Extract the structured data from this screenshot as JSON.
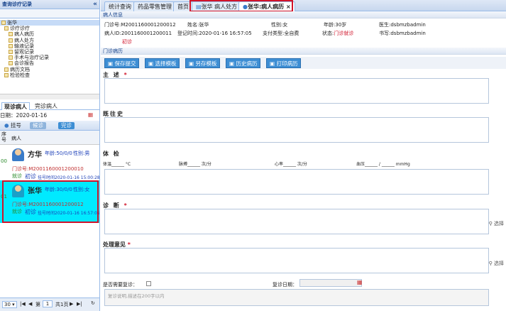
{
  "left": {
    "panel_title": "查询诊疗记录",
    "tree": [
      "张华",
      "诊疗诊疗",
      "病人病历",
      "病人处方",
      "输液记录",
      "留观记录",
      "手术与治疗记录",
      "会诊报告",
      "病历文档",
      "检验检查"
    ],
    "tabs": [
      "现诊病人",
      "完诊病人"
    ],
    "date_label": "日期：",
    "date_value": "2020-01-16",
    "btn_register": "挂号",
    "btn_waiting": "候诊",
    "btn_done": "完诊",
    "grid_col1": "序号",
    "grid_col2": "病人",
    "patients": [
      {
        "index": "00",
        "name": "方华",
        "age": "年龄:50/0/0",
        "sex": "性别:男",
        "no": "门诊号:M2001160001200010",
        "status": "就诊",
        "type": "初诊",
        "time": "挂号时间2020-01-16 15:00:28"
      },
      {
        "index": "01",
        "name": "张华",
        "age": "年龄:30/0/0",
        "sex": "性别:女",
        "no": "门诊号:M2001160001200012",
        "status": "就诊",
        "type": "初诊",
        "time": "挂号时间2020-01-16 16:57:05"
      }
    ],
    "pager": {
      "size": "30",
      "page_label": "第",
      "page": "1",
      "total": "共1页"
    }
  },
  "tabs": [
    "统计查询",
    "药品零售管理",
    "首页",
    "张华 病人处方",
    "张华:病人病历"
  ],
  "patient_info": {
    "section": "病人信息",
    "outpatient_no_label": "门诊号:",
    "outpatient_no": "M2001160001200012",
    "patient_id_label": "病人ID:",
    "patient_id": "2001160001200011",
    "first_visit": "初诊",
    "name_label": "姓名:",
    "name": "张华",
    "reg_time_label": "登记时间:",
    "reg_time": "2020-01-16 16:57:05",
    "sex_label": "性别:",
    "sex": "女",
    "pay_label": "支付类型:",
    "pay": "全自费",
    "age_label": "年龄:",
    "age": "30岁",
    "status_label": "状态:",
    "status": "门诊就诊",
    "doctor_label": "医生:",
    "doctor": "dsbmzbadmin",
    "clerk_label": "书写:",
    "clerk": "dsbmzbadmin"
  },
  "record": {
    "section": "门诊病历",
    "buttons": [
      "保存提交",
      "选择模板",
      "另存模板",
      "历史病历",
      "打印病历"
    ],
    "chief": "主  述",
    "history": "既往史",
    "exam": "体  检",
    "vitals": {
      "temp": "体温______ °C",
      "pulse": "脉搏______ 次/分",
      "breath": "心率______ 次/分",
      "bp": "血压______ / ______ mmHg"
    },
    "diagnosis": "诊  断",
    "treatment": "处理意见",
    "select": "选择",
    "revisit_label": "是否需要复诊：",
    "revisit_date_label": "复诊日期：",
    "note_placeholder": "复诊说明,描述在200字以内"
  }
}
